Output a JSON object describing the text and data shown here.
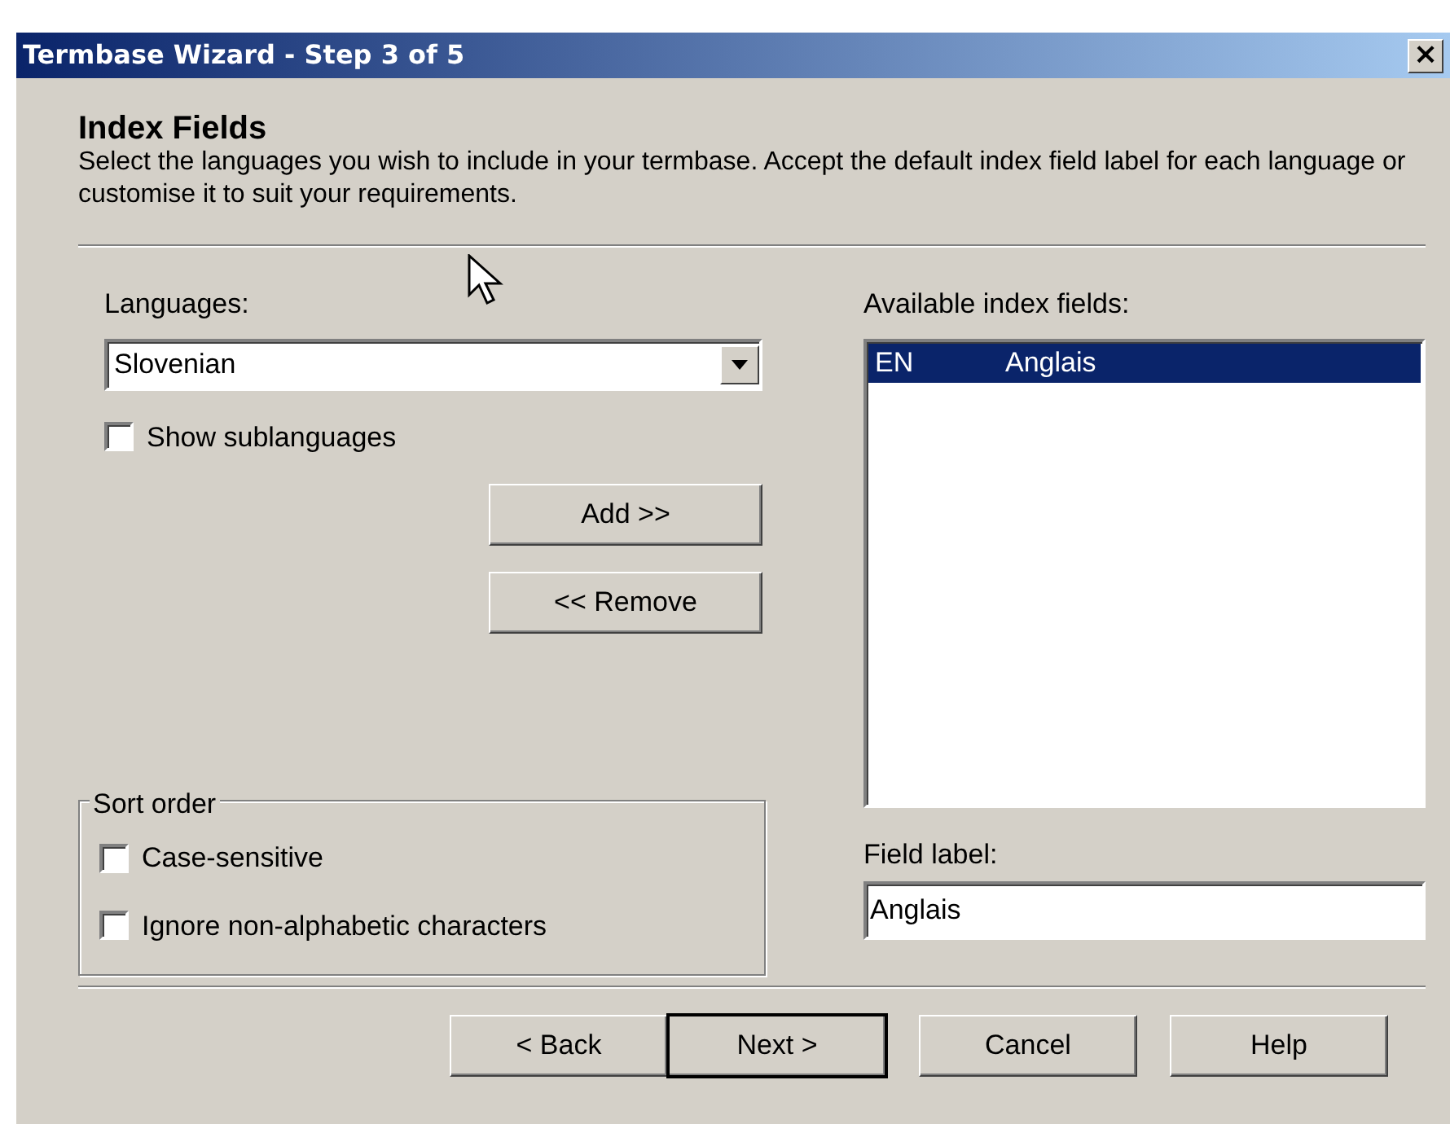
{
  "window": {
    "title": "Termbase Wizard - Step 3 of 5",
    "close": "×"
  },
  "header": {
    "title": "Index Fields",
    "description": "Select the languages you wish to include in your termbase. Accept the default index field label for each language or customise it to suit your requirements."
  },
  "languages": {
    "label": "Languages:",
    "value": "Slovenian"
  },
  "show_sublanguages": {
    "label": "Show sublanguages",
    "checked": false
  },
  "add_button": "Add >>",
  "remove_button": "<< Remove",
  "sort_order": {
    "title": "Sort order",
    "options": [
      {
        "label": "Case-sensitive",
        "checked": false
      },
      {
        "label": "Ignore non-alphabetic characters",
        "checked": false
      }
    ]
  },
  "available_index_fields": {
    "label": "Available index fields:",
    "rows": [
      {
        "code": "EN",
        "name": "Anglais",
        "selected": true
      }
    ]
  },
  "field_label": {
    "label": "Field label:",
    "value": "Anglais"
  },
  "buttons": [
    {
      "label": "< Back",
      "default": false
    },
    {
      "label": "Next >",
      "default": true
    },
    {
      "label": "Cancel",
      "default": false
    },
    {
      "label": "Help",
      "default": false
    }
  ]
}
